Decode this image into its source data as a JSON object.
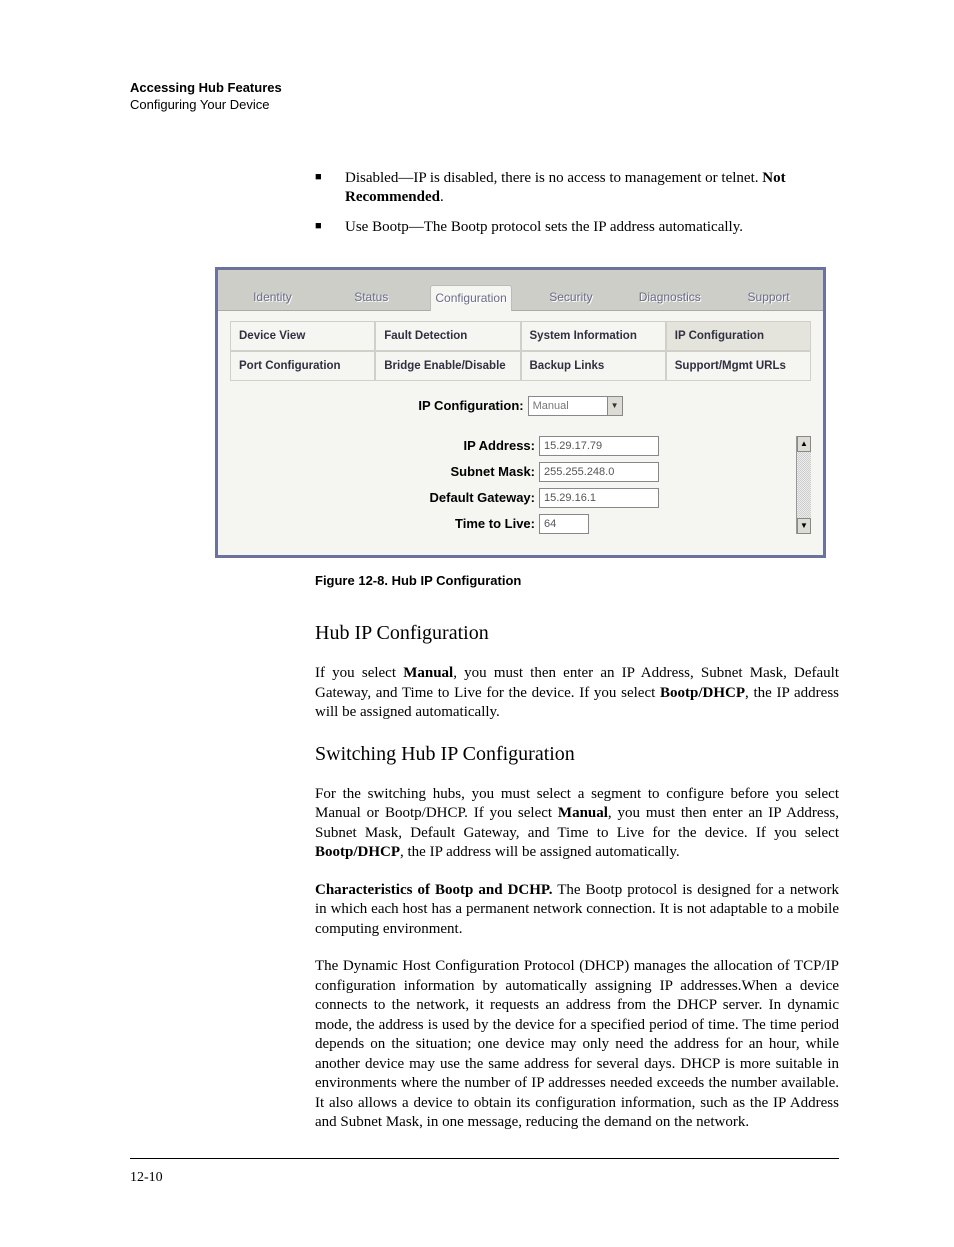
{
  "header": {
    "title": "Accessing Hub Features",
    "subtitle": "Configuring Your Device"
  },
  "bullets": {
    "b1_pre": "Disabled—IP is disabled, there is no access to management or telnet. ",
    "b1_bold": "Not Recommended",
    "b1_post": ".",
    "b2": "Use Bootp—The Bootp protocol sets the IP address automatically."
  },
  "figure": {
    "top_tabs": [
      "Identity",
      "Status",
      "Configuration",
      "Security",
      "Diagnostics",
      "Support"
    ],
    "sub_tabs_row1": [
      "Device View",
      "Fault Detection",
      "System Information",
      "IP Configuration"
    ],
    "sub_tabs_row2": [
      "Port Configuration",
      "Bridge Enable/Disable",
      "Backup Links",
      "Support/Mgmt URLs"
    ],
    "ip_config_label": "IP Configuration:",
    "ip_config_value": "Manual",
    "fields": {
      "ip_label": "IP Address:",
      "ip_value": "15.29.17.79",
      "subnet_label": "Subnet Mask:",
      "subnet_value": "255.255.248.0",
      "gateway_label": "Default Gateway:",
      "gateway_value": "15.29.16.1",
      "ttl_label": "Time to Live:",
      "ttl_value": "64"
    }
  },
  "caption": "Figure 12-8.  Hub IP Configuration",
  "sections": {
    "s1_title": "Hub IP Configuration",
    "s1_p1_a": "If you select ",
    "s1_p1_bold1": "Manual",
    "s1_p1_b": ", you must then enter an IP Address, Subnet Mask, Default Gateway, and Time to Live for the device. If you select ",
    "s1_p1_bold2": "Bootp/DHCP",
    "s1_p1_c": ", the IP address will be assigned automatically.",
    "s2_title": "Switching Hub IP Configuration",
    "s2_p1_a": "For the switching hubs, you must select a segment to configure before you select Manual or Bootp/DHCP. If you select ",
    "s2_p1_bold1": "Manual",
    "s2_p1_b": ", you must then enter an IP Address, Subnet Mask, Default Gateway, and Time to Live for the device. If you select ",
    "s2_p1_bold2": "Bootp/DHCP",
    "s2_p1_c": ", the IP address will be assigned automatically.",
    "s2_p2_bold": "Characteristics of Bootp and DCHP.",
    "s2_p2_rest": "   The Bootp protocol is designed for a network in which each host has a permanent network connection. It is not adaptable to a mobile computing environment.",
    "s2_p3": "The Dynamic Host Configuration Protocol (DHCP) manages the allocation of TCP/IP configuration information by automatically assigning IP addresses.When a device connects to the network, it requests an address from the DHCP server. In dynamic mode, the address is used by the device for a specified period of time. The time period depends on the situation; one device may only need the address for an hour, while another device may use the same address for several days. DHCP is more suitable in environments where the number of IP addresses needed exceeds the number available. It also allows a device to obtain its configuration information, such as the IP Address and Subnet Mask, in one message, reducing the demand on the network."
  },
  "page_number": "12-10"
}
